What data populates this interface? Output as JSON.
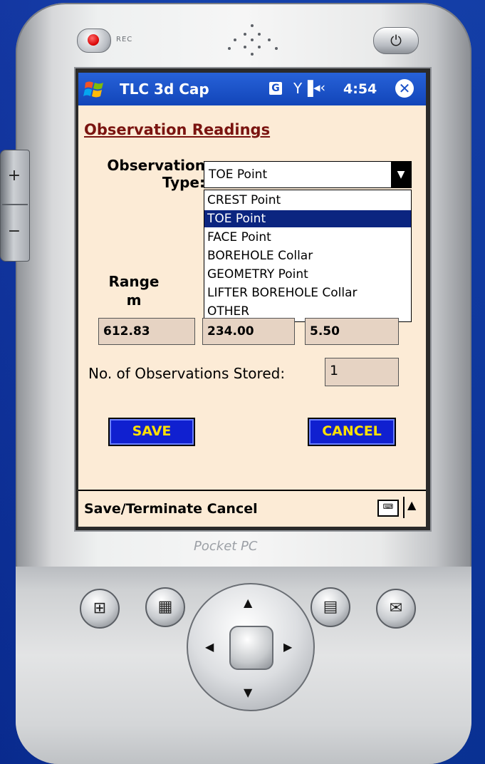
{
  "device": {
    "rec_label": "REC",
    "brand": "Pocket PC",
    "side_plus": "+",
    "side_minus": "−",
    "power_glyph": "⏻"
  },
  "titlebar": {
    "app_title": "TLC 3d Cap",
    "g_badge": "G",
    "signal_glyph": "Y▐",
    "volume_glyph": "◂‹",
    "clock": "4:54",
    "close_glyph": "✕"
  },
  "form": {
    "heading": "Observation Readings",
    "observation_type_label_line1": "Observation",
    "observation_type_label_line2": "Type:",
    "selected_value": "TOE Point",
    "options": [
      "CREST Point",
      "TOE Point",
      "FACE Point",
      "BOREHOLE Collar",
      "GEOMETRY Point",
      "LIFTER BOREHOLE Collar",
      "OTHER"
    ],
    "selected_index": 1,
    "range_label_line1": "Range",
    "range_label_line2": "m",
    "range_value": "612.83",
    "field2_value": "234.00",
    "field3_value": "5.50",
    "count_label": "No. of Observations Stored:",
    "count_value": "1",
    "save_label": "SAVE",
    "cancel_label": "CANCEL"
  },
  "cmdbar": {
    "text": "Save/Terminate Cancel",
    "arrow_glyph": "▲"
  },
  "hardware_buttons": {
    "windows_glyph": "⊞",
    "calendar_glyph": "▦",
    "contacts_glyph": "▤",
    "inbox_glyph": "✉"
  },
  "colors": {
    "background": "#0b3aa8",
    "titlebar": "#1850c8",
    "content_bg": "#fcebd6",
    "heading": "#7a1410",
    "selected_item": "#0b2580",
    "button_bg": "#1020d0",
    "button_text": "#ffe100"
  }
}
